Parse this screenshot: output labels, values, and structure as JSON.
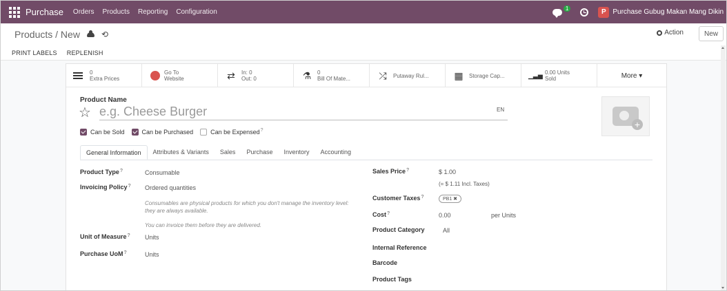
{
  "nav": {
    "app": "Purchase",
    "menu": [
      "Orders",
      "Products",
      "Reporting",
      "Configuration"
    ],
    "chat_badge": "1",
    "avatar_letter": "P",
    "company": "Purchase Gubug Makan Mang Dikin"
  },
  "control": {
    "breadcrumb": "Products / New",
    "undo_glyph": "⟲",
    "action_label": "Action",
    "new_label": "New"
  },
  "header_buttons": [
    "PRINT LABELS",
    "REPLENISH"
  ],
  "smart_buttons": {
    "extra_prices": {
      "line1": "0",
      "line2": "Extra Prices"
    },
    "website": {
      "line1": "Go To",
      "line2": "Website"
    },
    "in_out": {
      "line1": "In: 0",
      "line2": "Out: 0"
    },
    "bom": {
      "line1": "0",
      "line2": "Bill Of Mate..."
    },
    "putaway": {
      "line1": "Putaway Rul..."
    },
    "storage": {
      "line1": "Storage Cap..."
    },
    "sold": {
      "line1": "0.00 Units",
      "line2": "Sold"
    },
    "more": "More ▾"
  },
  "product": {
    "name_label": "Product Name",
    "name_placeholder": "e.g. Cheese Burger",
    "lang": "EN"
  },
  "checkboxes": [
    {
      "label": "Can be Sold",
      "checked": true
    },
    {
      "label": "Can be Purchased",
      "checked": true
    },
    {
      "label": "Can be Expensed",
      "checked": false
    }
  ],
  "tabs": [
    "General Information",
    "Attributes & Variants",
    "Sales",
    "Purchase",
    "Inventory",
    "Accounting"
  ],
  "left_fields": {
    "product_type": {
      "label": "Product Type",
      "value": "Consumable"
    },
    "invoicing_policy": {
      "label": "Invoicing Policy",
      "value": "Ordered quantities"
    },
    "help1": "Consumables are physical products for which you don't manage the inventory level: they are always available.",
    "help2": "You can invoice them before they are delivered.",
    "uom": {
      "label": "Unit of Measure",
      "value": "Units"
    },
    "purchase_uom": {
      "label": "Purchase UoM",
      "value": "Units"
    }
  },
  "right_fields": {
    "sales_price": {
      "label": "Sales Price",
      "value": "$ 1.00",
      "incl": "(= $ 1.11 Incl. Taxes)"
    },
    "customer_taxes": {
      "label": "Customer Taxes",
      "tag": "PB1 ✖"
    },
    "cost": {
      "label": "Cost",
      "value": "0.00",
      "unit": "per Units"
    },
    "category": {
      "label": "Product Category",
      "value": "All"
    },
    "internal_ref": {
      "label": "Internal Reference"
    },
    "barcode": {
      "label": "Barcode"
    },
    "tags": {
      "label": "Product Tags"
    }
  },
  "tooltip_mark": "?",
  "icons": {
    "star": "☆",
    "transfer": "⇄",
    "flask": "⚗",
    "shuffle": "⤮",
    "boxes": "▦",
    "bars": "▁▃▅"
  },
  "colors": {
    "primary": "#714B67",
    "danger": "#d9534f"
  }
}
